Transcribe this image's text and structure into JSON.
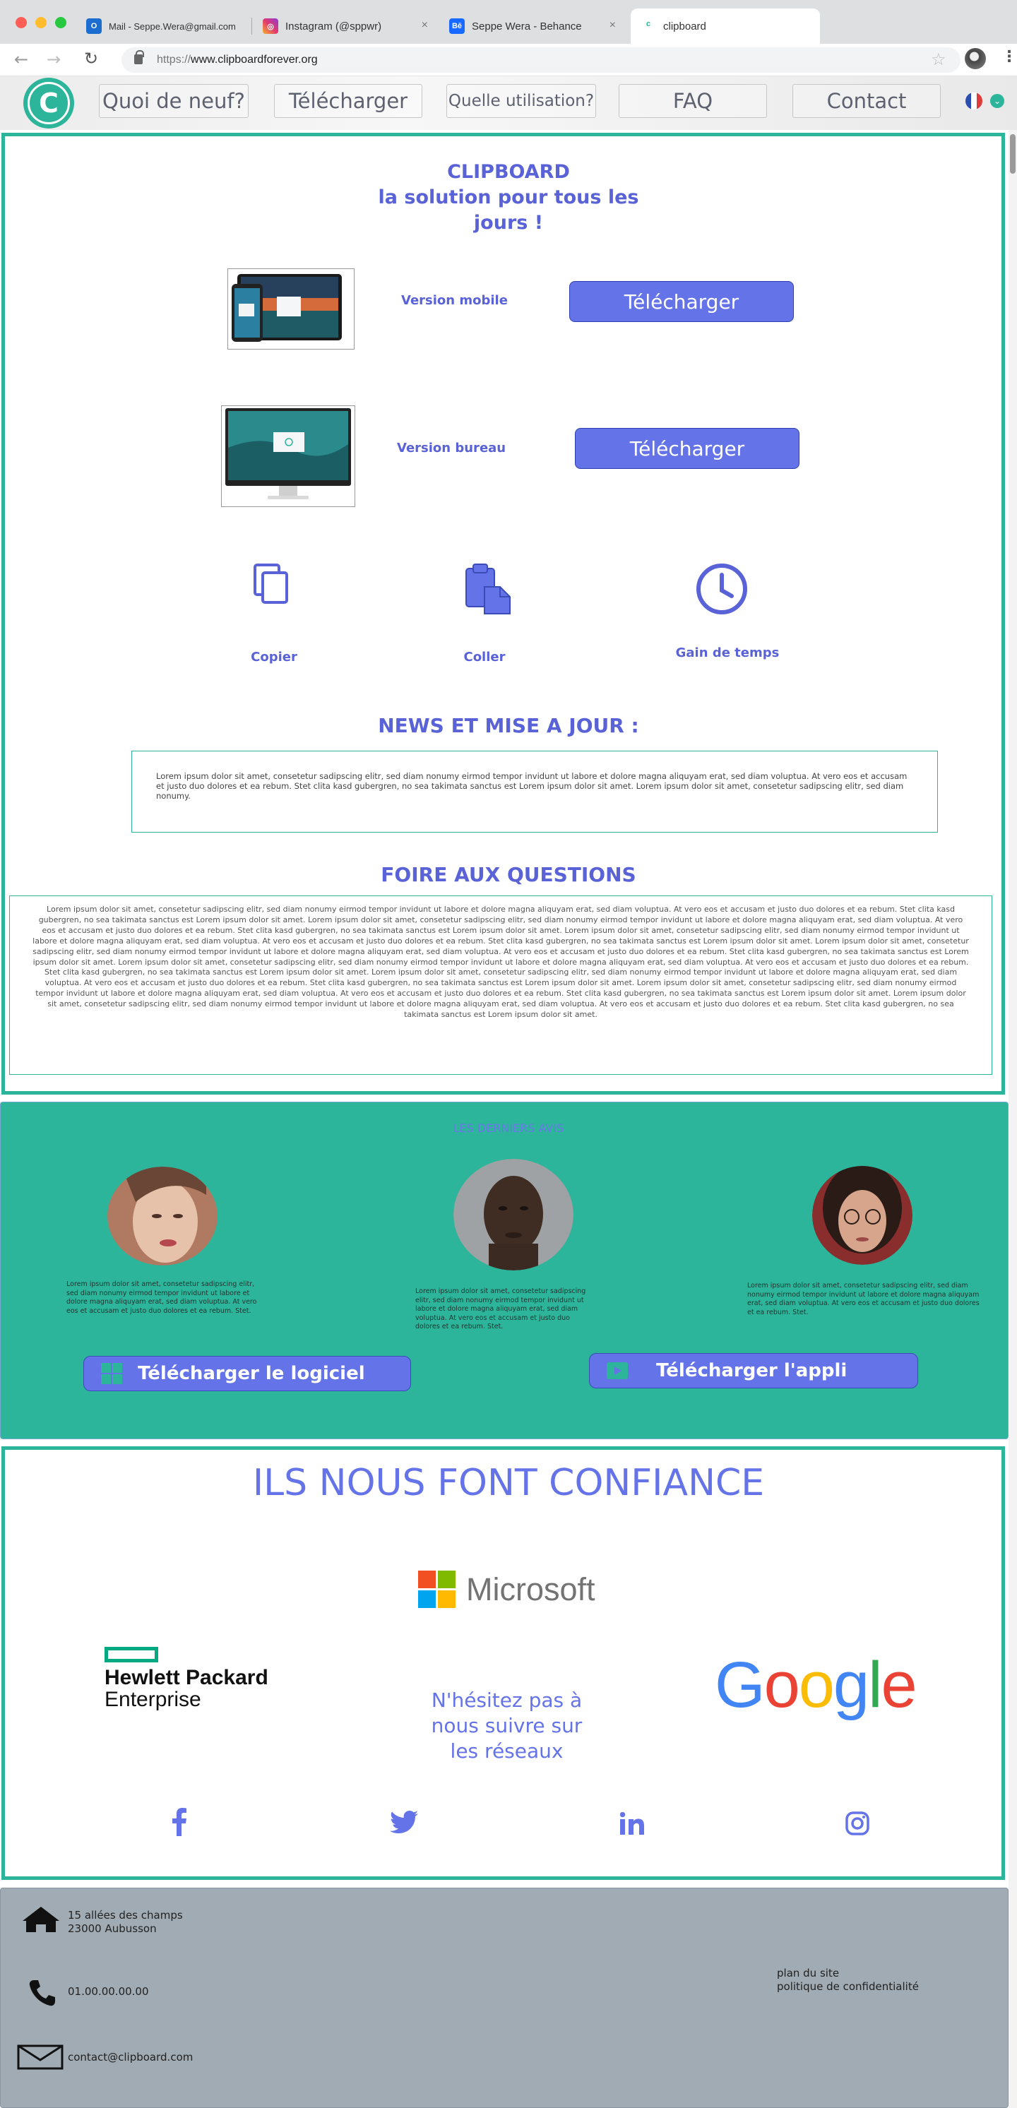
{
  "browser": {
    "tabs": [
      {
        "title": "Mail - Seppe.Wera@gmail.com",
        "icon": "outlook-icon"
      },
      {
        "title": "Instagram (@sppwr)",
        "icon": "instagram-icon"
      },
      {
        "title": "Seppe Wera - Behance",
        "icon": "behance-icon"
      },
      {
        "title": "clipboard",
        "icon": "clipboard-icon"
      }
    ],
    "url_prefix": "https://",
    "url_host": "www.clipboardforever.org"
  },
  "nav": {
    "logo": "C",
    "links": [
      "Quoi de neuf?",
      "Télécharger",
      "Quelle utilisation?",
      "FAQ",
      "Contact"
    ]
  },
  "hero": {
    "title1": "CLIPBOARD",
    "title2": "la solution pour tous les",
    "title3": "jours !"
  },
  "versions": [
    {
      "label": "Version mobile",
      "button": "Télécharger"
    },
    {
      "label": "Version bureau",
      "button": "Télécharger"
    }
  ],
  "features": [
    {
      "label": "Copier",
      "icon": "copy-icon"
    },
    {
      "label": "Coller",
      "icon": "paste-icon"
    },
    {
      "label": "Gain de temps",
      "icon": "clock-icon"
    }
  ],
  "news": {
    "heading": "NEWS ET MISE A JOUR :",
    "text": "Lorem ipsum dolor sit amet, consetetur sadipscing elitr, sed diam nonumy eirmod tempor invidunt ut labore et dolore magna aliquyam erat, sed diam voluptua. At vero eos et accusam et justo duo dolores et ea rebum. Stet clita kasd gubergren, no sea takimata sanctus est Lorem ipsum dolor sit amet. Lorem ipsum dolor sit amet, consetetur sadipscing elitr, sed diam nonumy."
  },
  "faq": {
    "heading": "FOIRE AUX QUESTIONS",
    "text": "Lorem ipsum dolor sit amet, consetetur sadipscing elitr, sed diam nonumy eirmod tempor invidunt ut labore et dolore magna aliquyam erat, sed diam voluptua. At vero eos et accusam et justo duo dolores et ea rebum. Stet clita kasd gubergren, no sea takimata sanctus est Lorem ipsum dolor sit amet. Lorem ipsum dolor sit amet, consetetur sadipscing elitr, sed diam nonumy eirmod tempor invidunt ut labore et dolore magna aliquyam erat, sed diam voluptua. At vero eos et accusam et justo duo dolores et ea rebum. Stet clita kasd gubergren, no sea takimata sanctus est Lorem ipsum dolor sit amet. Lorem ipsum dolor sit amet, consetetur sadipscing elitr, sed diam nonumy eirmod tempor invidunt ut labore et dolore magna aliquyam erat, sed diam voluptua. At vero eos et accusam et justo duo dolores et ea rebum. Stet clita kasd gubergren, no sea takimata sanctus est Lorem ipsum dolor sit amet. Lorem ipsum dolor sit amet, consetetur sadipscing elitr, sed diam nonumy eirmod tempor invidunt ut labore et dolore magna aliquyam erat, sed diam voluptua. At vero eos et accusam et justo duo dolores et ea rebum. Stet clita kasd gubergren, no sea takimata sanctus est Lorem ipsum dolor sit amet. Lorem ipsum dolor sit amet, consetetur sadipscing elitr, sed diam nonumy eirmod tempor invidunt ut labore et dolore magna aliquyam erat, sed diam voluptua. At vero eos et accusam et justo duo dolores et ea rebum. Stet clita kasd gubergren, no sea takimata sanctus est Lorem ipsum dolor sit amet. Lorem ipsum dolor sit amet, consetetur sadipscing elitr, sed diam nonumy eirmod tempor invidunt ut labore et dolore magna aliquyam erat, sed diam voluptua. At vero eos et accusam et justo duo dolores et ea rebum. Stet clita kasd gubergren, no sea takimata sanctus est Lorem ipsum dolor sit amet. Lorem ipsum dolor sit amet, consetetur sadipscing elitr, sed diam nonumy eirmod tempor invidunt ut labore et dolore magna aliquyam erat, sed diam voluptua. At vero eos et accusam et justo duo dolores et ea rebum. Stet clita kasd gubergren, no sea takimata sanctus est Lorem ipsum dolor sit amet. Lorem ipsum dolor sit amet, consetetur sadipscing elitr, sed diam nonumy eirmod tempor invidunt ut labore et dolore magna aliquyam erat, sed diam voluptua. At vero eos et accusam et justo duo dolores et ea rebum. Stet clita kasd gubergren, no sea takimata sanctus est Lorem ipsum dolor sit amet."
  },
  "reviews": {
    "heading": "LES DERNIERS AVIS",
    "items": [
      {
        "text": "Lorem ipsum dolor sit amet, consetetur sadipscing elitr, sed diam nonumy eirmod tempor invidunt ut labore et dolore magna aliquyam erat, sed diam voluptua. At vero eos et accusam et justo duo dolores et ea rebum. Stet."
      },
      {
        "text": "Lorem ipsum dolor sit amet, consetetur sadipscing elitr, sed diam nonumy eirmod tempor invidunt ut labore et dolore magna aliquyam erat, sed diam voluptua. At vero eos et accusam et justo duo dolores et ea rebum. Stet."
      },
      {
        "text": "Lorem ipsum dolor sit amet, consetetur sadipscing elitr, sed diam nonumy eirmod tempor invidunt ut labore et dolore magna aliquyam erat, sed diam voluptua. At vero eos et accusam et justo duo dolores et ea rebum. Stet."
      }
    ],
    "cta_software": "Télécharger le logiciel",
    "cta_app": "Télécharger l'appli"
  },
  "trust": {
    "heading": "ILS NOUS FONT CONFIANCE",
    "microsoft": "Microsoft",
    "hpe_line1": "Hewlett Packard",
    "hpe_line2": "Enterprise",
    "google": [
      "G",
      "o",
      "o",
      "g",
      "l",
      "e"
    ],
    "follow1": "N'hésitez pas à",
    "follow2": "nous suivre sur",
    "follow3": "les réseaux",
    "socials": [
      "facebook-icon",
      "twitter-icon",
      "linkedin-icon",
      "instagram-icon"
    ]
  },
  "footer": {
    "address1": "15 allées des champs",
    "address2": "23000 Aubusson",
    "phone": "01.00.00.00.00",
    "email": "contact@clipboard.com",
    "sitemap": "plan du site",
    "privacy": "politique de confidentialité"
  },
  "colors": {
    "teal": "#2cb59a",
    "indigo": "#5962d6",
    "button": "#6473e8",
    "footer": "#a1abb3"
  }
}
